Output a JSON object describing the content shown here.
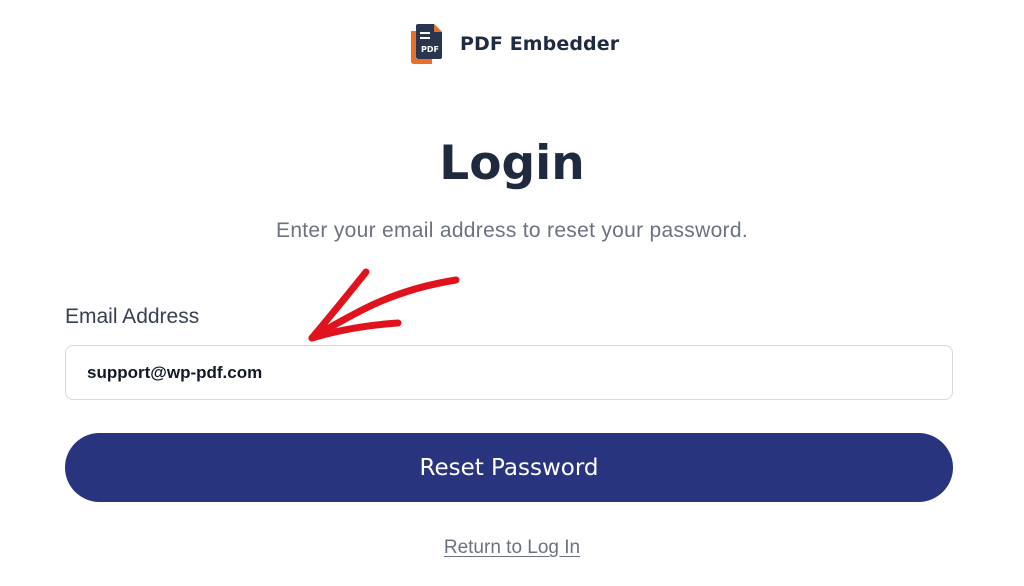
{
  "brand": {
    "name": "PDF Embedder",
    "logo_text": "PDF",
    "logo_colors": {
      "page": "#2a3550",
      "accent": "#e8702a"
    }
  },
  "heading": {
    "title": "Login",
    "subtitle": "Enter your email address to reset your password."
  },
  "form": {
    "email_label": "Email Address",
    "email_value": "support@wp-pdf.com",
    "submit_label": "Reset Password",
    "return_link": "Return to Log In"
  },
  "annotation": {
    "icon": "red-arrow-icon",
    "color": "#e0121b"
  },
  "colors": {
    "button": "#28347e",
    "title": "#1f2a3e",
    "muted_text": "#6b7280"
  }
}
